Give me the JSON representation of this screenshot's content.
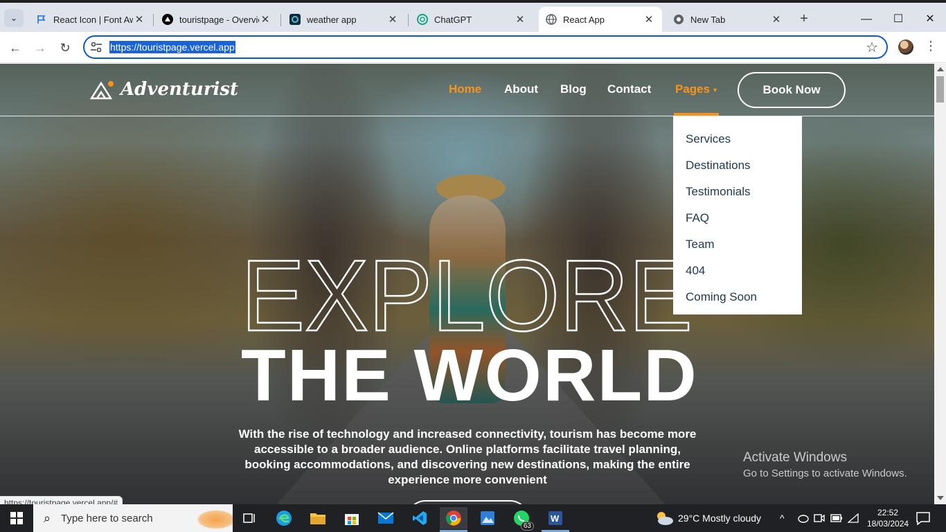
{
  "browser": {
    "tabs": [
      {
        "title": "React Icon | Font Awe",
        "icon": "flag-icon"
      },
      {
        "title": "touristpage - Overvie",
        "icon": "vercel-icon"
      },
      {
        "title": "weather app",
        "icon": "replit-icon"
      },
      {
        "title": "ChatGPT",
        "icon": "chatgpt-icon"
      },
      {
        "title": "React App",
        "icon": "globe-icon"
      },
      {
        "title": "New Tab",
        "icon": "chrome-icon"
      }
    ],
    "active_tab": 4,
    "url": "https://touristpage.vercel.app",
    "status_url": "https://touristpage.vercel.app/#"
  },
  "site": {
    "logo": "Adventurist",
    "nav": {
      "home": "Home",
      "about": "About",
      "blog": "Blog",
      "contact": "Contact",
      "pages": "Pages",
      "book": "Book Now"
    },
    "dropdown": [
      "Services",
      "Destinations",
      "Testimonials",
      "FAQ",
      "Team",
      "404",
      "Coming Soon"
    ],
    "hero": {
      "line1": "EXPLORE",
      "line2": "THE WORLD",
      "text": "With the rise of technology and increased connectivity, tourism has become more accessible to a broader audience. Online platforms facilitate travel planning, booking accommodations, and discovering new destinations, making the entire experience more convenient"
    },
    "accent_color": "#f7941d"
  },
  "watermark": {
    "line1": "Activate Windows",
    "line2": "Go to Settings to activate Windows."
  },
  "taskbar": {
    "search_placeholder": "Type here to search",
    "whatsapp_badge": "63",
    "weather": "29°C  Mostly cloudy",
    "time": "22:52",
    "date": "18/03/2024"
  }
}
